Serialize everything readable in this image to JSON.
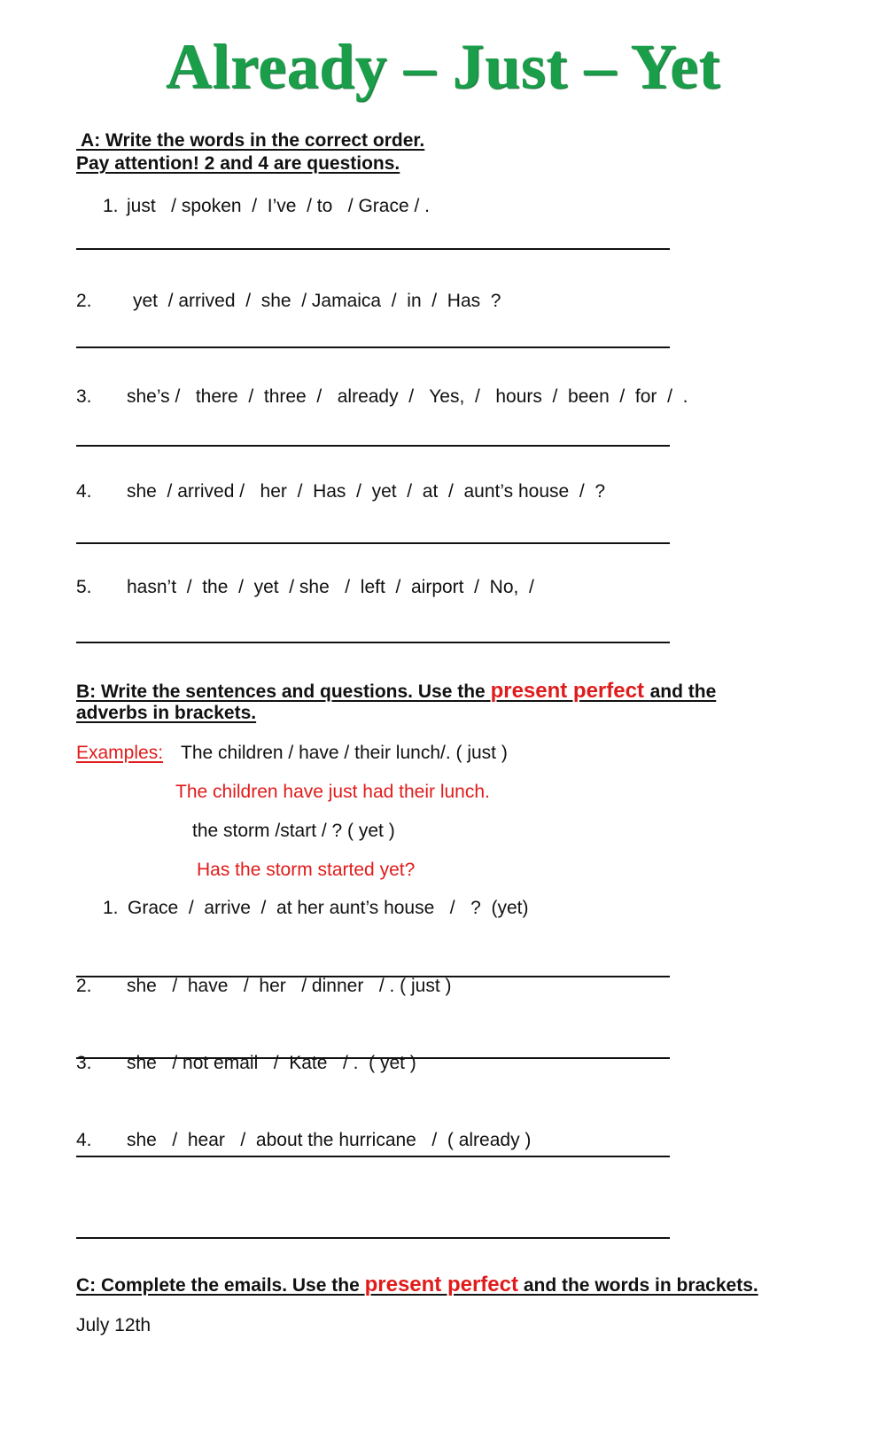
{
  "title": "Already – Just – Yet",
  "section_a": {
    "heading_line1": " A: Write the words in the correct order.",
    "heading_line2": "Pay attention! 2 and 4 are questions.",
    "items": [
      {
        "number": "1.",
        "words": "just   / spoken  /  I’ve  / to   / Grace / ."
      },
      {
        "number": "2.",
        "words": "yet  / arrived  /  she  / Jamaica  /  in  /  Has  ?"
      },
      {
        "number": "3.",
        "words": "she’s /   there  /  three  /   already  /   Yes,  /   hours  /  been  /  for  /  ."
      },
      {
        "number": "4.",
        "words": "she  / arrived /   her  /  Has  /  yet  /  at  /  aunt’s house  /  ?"
      },
      {
        "number": "5.",
        "words": "hasn’t  /  the  /  yet  / she   /  left  /  airport  /  No,  /"
      }
    ]
  },
  "section_b": {
    "heading_pre": "B: Write the sentences and questions. Use the ",
    "heading_accent": "present perfect ",
    "heading_post": "and the",
    "heading_line2": "adverbs in brackets.",
    "examples_label": "Examples:",
    "example1_prompt": "The children / have / their lunch/. ( just )",
    "example1_answer": "The children have just had their lunch.",
    "example2_prompt": "the storm /start / ? ( yet )",
    "example2_answer": "Has the storm started yet?",
    "items": [
      {
        "number": "1.",
        "words": "Grace  /  arrive  /  at her aunt’s house   /   ?  (yet)"
      },
      {
        "number": "2.",
        "words": "she   /  have   /  her   / dinner   / . ( just )"
      },
      {
        "number": "3.",
        "words": "she   / not email   /  Kate   / .  ( yet )"
      },
      {
        "number": "4.",
        "words": "she   /  hear   /  about the hurricane   /  ( already )"
      }
    ]
  },
  "section_c": {
    "heading_pre": "C: Complete the emails. Use the ",
    "heading_accent": "present perfect",
    "heading_post": " and the words in brackets.",
    "date": "July 12th"
  },
  "colors": {
    "title_green": "#1a9e4a",
    "accent_red": "#e01b1b"
  }
}
